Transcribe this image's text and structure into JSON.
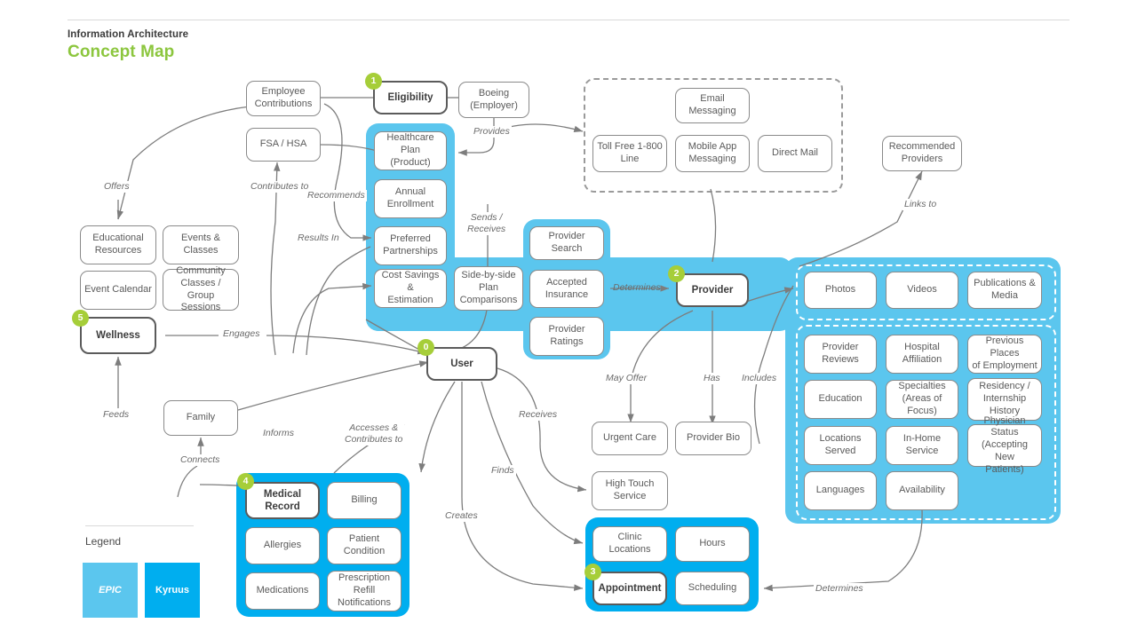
{
  "header": {
    "eyebrow": "Information Architecture",
    "title": "Concept Map"
  },
  "legend": {
    "title": "Legend",
    "items": [
      {
        "label": "EPIC",
        "color": "#5bc6ee"
      },
      {
        "label": "Kyruus",
        "color": "#00aeef"
      }
    ]
  },
  "colors": {
    "epic": "#5bc6ee",
    "kyruus": "#00aeef",
    "badge": "#a6ce39",
    "accent_title": "#8cc63e",
    "node_border": "#8a8a8a",
    "primary_border": "#5b5b5b",
    "text": "#5a5a5a"
  },
  "badges": [
    {
      "id": "0",
      "for": "user"
    },
    {
      "id": "1",
      "for": "eligibility"
    },
    {
      "id": "2",
      "for": "provider"
    },
    {
      "id": "3",
      "for": "appointment"
    },
    {
      "id": "4",
      "for": "medical-record"
    },
    {
      "id": "5",
      "for": "wellness"
    }
  ],
  "nodes": {
    "employee_contributions": "Employee\nContributions",
    "fsa_hsa": "FSA / HSA",
    "eligibility": "Eligibility",
    "boeing": "Boeing\n(Employer)",
    "healthcare_plan": "Healthcare Plan\n(Product)",
    "annual_enrollment": "Annual\nEnrollment",
    "preferred_partnerships": "Preferred\nPartnerships",
    "cost_savings": "Cost Savings &\nEstimation",
    "side_by_side": "Side-by-side\nPlan\nComparisons",
    "email_messaging": "Email\nMessaging",
    "toll_free": "Toll Free 1-800\nLine",
    "mobile_app": "Mobile App\nMessaging",
    "direct_mail": "Direct Mail",
    "recommended_providers": "Recommended\nProviders",
    "provider_search": "Provider Search",
    "accepted_insurance": "Accepted\nInsurance",
    "provider_ratings": "Provider\nRatings",
    "provider": "Provider",
    "educational_resources": "Educational\nResources",
    "events_classes": "Events &\nClasses",
    "event_calendar": "Event Calendar",
    "community_classes": "Community\nClasses / Group\nSessions",
    "wellness": "Wellness",
    "user": "User",
    "family": "Family",
    "urgent_care": "Urgent Care",
    "provider_bio": "Provider Bio",
    "high_touch": "High Touch\nService",
    "photos": "Photos",
    "videos": "Videos",
    "publications_media": "Publications &\nMedia",
    "provider_reviews": "Provider\nReviews",
    "hospital_affiliation": "Hospital\nAffiliation",
    "previous_places": "Previous Places\nof Employment",
    "education": "Education",
    "specialties": "Specialties\n(Areas of Focus)",
    "residency": "Residency /\nInternship\nHistory",
    "locations_served": "Locations\nServed",
    "in_home_service": "In-Home\nService",
    "physician_status": "Physician Status\n(Accepting New\nPatients)",
    "languages": "Languages",
    "availability": "Availability",
    "medical_record": "Medical\nRecord",
    "billing": "Billing",
    "allergies": "Allergies",
    "patient_condition": "Patient\nCondition",
    "medications": "Medications",
    "prescription_refill": "Prescription\nRefill\nNotifications",
    "clinic_locations": "Clinic Locations",
    "hours": "Hours",
    "appointment": "Appointment",
    "scheduling": "Scheduling"
  },
  "edge_labels": {
    "provides": "Provides",
    "sends_receives": "Sends /\nReceives",
    "contributes_to": "Contributes to",
    "recommends": "Recommends",
    "results_in": "Results In",
    "offers": "Offers",
    "links_to": "Links to",
    "determines_provider": "Determines",
    "engages": "Engages",
    "may_offer": "May Offer",
    "has": "Has",
    "includes": "Includes",
    "receives": "Receives",
    "feeds": "Feeds",
    "connects": "Connects",
    "informs": "Informs",
    "accesses_contributes": "Accesses &\nContributes to",
    "finds": "Finds",
    "creates": "Creates",
    "determines_scheduling": "Determines"
  }
}
